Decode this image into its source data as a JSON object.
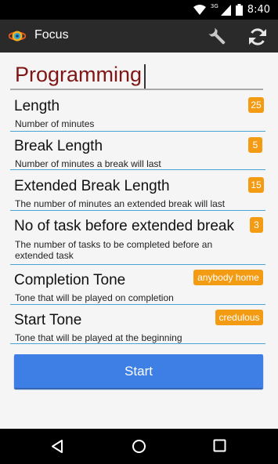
{
  "status_bar": {
    "network": "3G",
    "time": "8:40"
  },
  "action_bar": {
    "title": "Focus"
  },
  "task_name": "Programming",
  "settings": [
    {
      "title": "Length",
      "description": "Number of minutes",
      "value": "25"
    },
    {
      "title": "Break Length",
      "description": "Number of minutes a break will last",
      "value": "5"
    },
    {
      "title": "Extended Break Length",
      "description": "The number of minutes an extended break will last",
      "value": "15"
    },
    {
      "title": "No of task before extended break",
      "description_line1": "The number of tasks to be completed before an",
      "description_line2": "extended task",
      "value": "3"
    },
    {
      "title": "Completion Tone",
      "description": "Tone that will be played on completion",
      "value": "anybody home"
    },
    {
      "title": "Start Tone",
      "description": "Tone that will be played at the beginning",
      "value": "credulous"
    }
  ],
  "start_label": "Start",
  "colors": {
    "accent": "#3e7fe6",
    "badge": "#f49b14",
    "divider": "#4aa3d8",
    "title_text": "#801515"
  },
  "icons": [
    "wifi-icon",
    "signal-icon",
    "battery-icon",
    "wrench-icon",
    "refresh-icon",
    "back-icon",
    "home-icon",
    "recents-icon"
  ]
}
